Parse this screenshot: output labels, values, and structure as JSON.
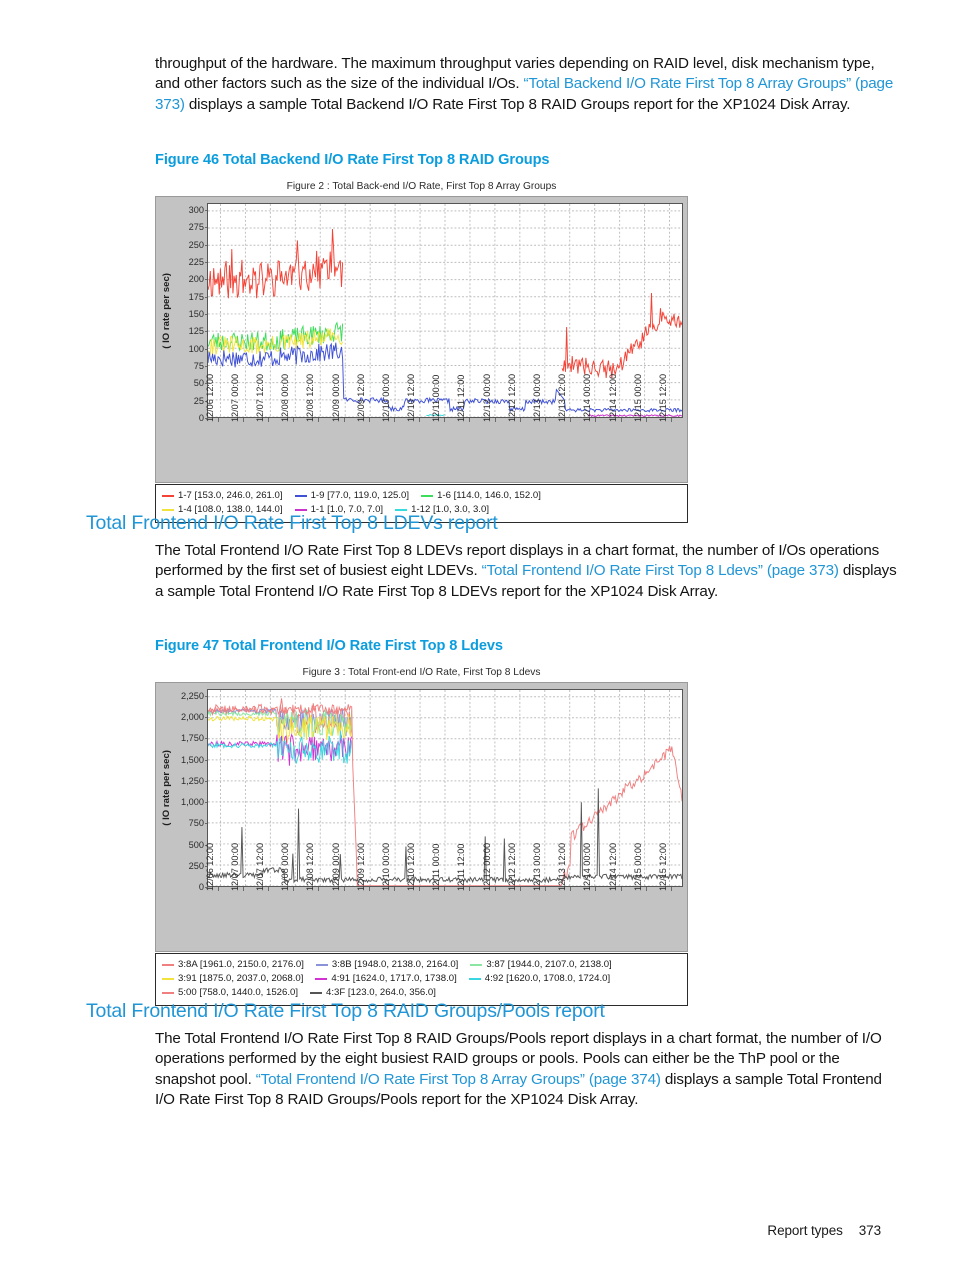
{
  "page": {
    "footer_label": "Report types",
    "page_number": "373",
    "accent_color": "#2196d6",
    "figure_caption_color": "#0b9ddd"
  },
  "intro_paragraph": {
    "part1": "throughput of the hardware. The maximum throughput varies depending on RAID level, disk mechanism type, and other factors such as the size of the individual I/Os. ",
    "link": "“Total Backend I/O Rate First Top 8 Array Groups” (page 373)",
    "part2": " displays a sample Total Backend I/O Rate First Top 8 RAID Groups report for the XP1024 Disk Array."
  },
  "figure46": {
    "caption": "Figure 46 Total Backend I/O Rate First Top 8 RAID Groups"
  },
  "figure47": {
    "caption": "Figure 47 Total Frontend I/O Rate First Top 8 Ldevs"
  },
  "section_ldevs": {
    "heading": "Total Frontend I/O Rate First Top 8 LDEVs report",
    "para_part1": "The Total Frontend I/O Rate First Top 8 LDEVs report displays in a chart format, the number of I/Os operations performed by the first set of busiest eight LDEVs. ",
    "para_link": "“Total Frontend I/O Rate First Top 8 Ldevs” (page 373)",
    "para_part2": " displays a sample Total Frontend I/O Rate First Top 8 LDEVs report for the XP1024 Disk Array."
  },
  "section_raidpools": {
    "heading": "Total Frontend I/O Rate First Top 8 RAID Groups/Pools report",
    "para_part1": "The Total Frontend I/O Rate First Top 8 RAID Groups/Pools report displays in a chart format, the number of I/O operations performed by the eight busiest RAID groups or pools. Pools can either be the ThP pool or the snapshot pool. ",
    "para_link": "“Total Frontend I/O Rate First Top 8 Array Groups” (page 374)",
    "para_part2": " displays a sample Total Frontend I/O Rate First Top 8 RAID Groups/Pools report for the XP1024 Disk Array."
  },
  "chart_data": [
    {
      "id": "backend",
      "type": "line",
      "title": "Figure 2 : Total Back-end I/O Rate, First Top 8 Array Groups",
      "xlabel": "",
      "ylabel": "( IO rate per sec)",
      "ylim": [
        0,
        310
      ],
      "yticks": [
        0,
        25,
        50,
        75,
        100,
        125,
        150,
        175,
        200,
        225,
        250,
        275,
        300
      ],
      "ytick_labels": [
        "0",
        "25",
        "50",
        "75",
        "100",
        "125",
        "150",
        "175",
        "200",
        "225",
        "250",
        "275",
        "300"
      ],
      "grid": true,
      "legend_position": "below",
      "xticks": [
        "12/06 12:00",
        "12/07 00:00",
        "12/07 12:00",
        "12/08 00:00",
        "12/08 12:00",
        "12/09 00:00",
        "12/09 12:00",
        "12/10 00:00",
        "12/10 12:00",
        "12/11 00:00",
        "12/11 12:00",
        "12/12 00:00",
        "12/12 12:00",
        "12/13 00:00",
        "12/13 12:00",
        "12/14 00:00",
        "12/14 12:00",
        "12/15 00:00",
        "12/15 12:00"
      ],
      "series": [
        {
          "name": "1-7",
          "stats": [
            153.0,
            246.0,
            261.0
          ],
          "label": "1-7 [153.0, 246.0, 261.0]",
          "color": "#f44336"
        },
        {
          "name": "1-9",
          "stats": [
            77.0,
            119.0,
            125.0
          ],
          "label": "1-9 [77.0, 119.0, 125.0]",
          "color": "#3f51d5"
        },
        {
          "name": "1-6",
          "stats": [
            114.0,
            146.0,
            152.0
          ],
          "label": "1-6 [114.0, 146.0, 152.0]",
          "color": "#3ddc5a"
        },
        {
          "name": "1-4",
          "stats": [
            108.0,
            138.0,
            144.0
          ],
          "label": "1-4 [108.0, 138.0, 144.0]",
          "color": "#f2e33c"
        },
        {
          "name": "1-1",
          "stats": [
            1.0,
            7.0,
            7.0
          ],
          "label": "1-1 [1.0, 7.0, 7.0]",
          "color": "#cc33cc"
        },
        {
          "name": "1-12",
          "stats": [
            1.0,
            3.0,
            3.0
          ],
          "label": "1-12 [1.0, 3.0, 3.0]",
          "color": "#33dddd"
        }
      ]
    },
    {
      "id": "frontend",
      "type": "line",
      "title": "Figure 3 : Total Front-end I/O Rate, First Top 8 Ldevs",
      "xlabel": "",
      "ylabel": "( IO rate per sec)",
      "ylim": [
        0,
        2330
      ],
      "yticks": [
        0,
        250,
        500,
        750,
        1000,
        1250,
        1500,
        1750,
        2000,
        2250
      ],
      "ytick_labels": [
        "0",
        "250",
        "500",
        "750",
        "1,000",
        "1,250",
        "1,500",
        "1,750",
        "2,000",
        "2,250"
      ],
      "grid": true,
      "legend_position": "below",
      "xticks": [
        "12/06 12:00",
        "12/07 00:00",
        "12/07 12:00",
        "12/08 00:00",
        "12/08 12:00",
        "12/09 00:00",
        "12/09 12:00",
        "12/10 00:00",
        "12/10 12:00",
        "12/11 00:00",
        "12/11 12:00",
        "12/12 00:00",
        "12/12 12:00",
        "12/13 00:00",
        "12/13 12:00",
        "12/14 00:00",
        "12/14 12:00",
        "12/15 00:00",
        "12/15 12:00"
      ],
      "series": [
        {
          "name": "3:8A",
          "stats": [
            1961.0,
            2150.0,
            2176.0
          ],
          "label": "3:8A [1961.0, 2150.0, 2176.0]",
          "color": "#f08080"
        },
        {
          "name": "3:8B",
          "stats": [
            1948.0,
            2138.0,
            2164.0
          ],
          "label": "3:8B [1948.0, 2138.0, 2164.0]",
          "color": "#8a92d8"
        },
        {
          "name": "3:87",
          "stats": [
            1944.0,
            2107.0,
            2138.0
          ],
          "label": "3:87 [1944.0, 2107.0, 2138.0]",
          "color": "#8ae6a0"
        },
        {
          "name": "3:91",
          "stats": [
            1875.0,
            2037.0,
            2068.0
          ],
          "label": "3:91 [1875.0, 2037.0, 2068.0]",
          "color": "#f2e33c"
        },
        {
          "name": "4:91",
          "stats": [
            1624.0,
            1717.0,
            1738.0
          ],
          "label": "4:91 [1624.0, 1717.0, 1738.0]",
          "color": "#d431d4"
        },
        {
          "name": "4:92",
          "stats": [
            1620.0,
            1708.0,
            1724.0
          ],
          "label": "4:92 [1620.0, 1708.0, 1724.0]",
          "color": "#38d6e0"
        },
        {
          "name": "5:00",
          "stats": [
            758.0,
            1440.0,
            1526.0
          ],
          "label": "5:00 [758.0, 1440.0, 1526.0]",
          "color": "#f08080"
        },
        {
          "name": "4:3F",
          "stats": [
            123.0,
            264.0,
            356.0
          ],
          "label": "4:3F [123.0, 264.0, 356.0]",
          "color": "#555555"
        }
      ]
    }
  ]
}
